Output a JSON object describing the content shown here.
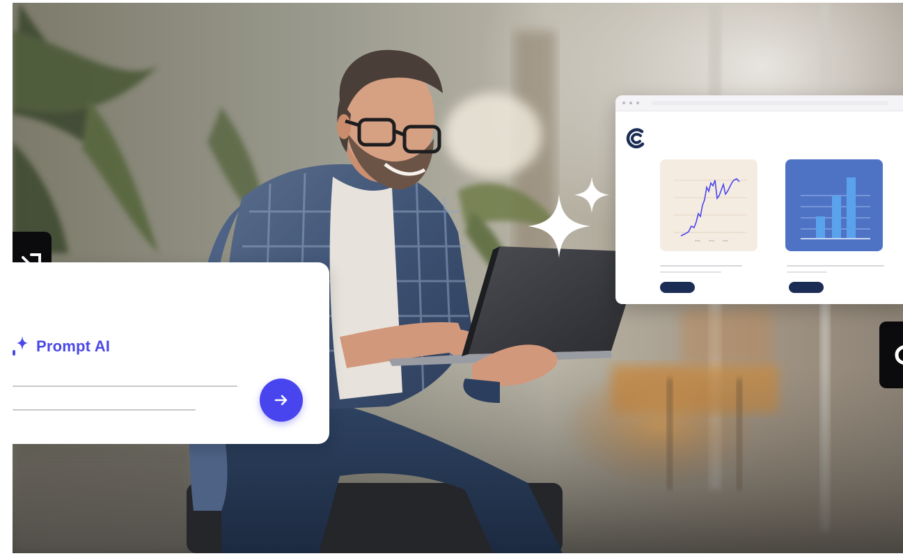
{
  "prompt_card": {
    "title": "Prompt AI",
    "send_icon": "arrow-right-icon",
    "sparkle_icon": "sparkle-icon"
  },
  "dashboard_card": {
    "logo_icon": "c-logo-icon",
    "line_chart_icon": "line-chart-icon",
    "bar_chart_icon": "bar-chart-icon"
  },
  "badges": {
    "left_icon": "slash-logo-icon",
    "right_icon": "c-logo-icon"
  },
  "colors": {
    "accent": "#4845ee",
    "prompt_text": "#4a49e6",
    "dashboard_blue": "#4e73c5",
    "chart_bg": "#f5ece1",
    "pill": "#1c2d55"
  }
}
